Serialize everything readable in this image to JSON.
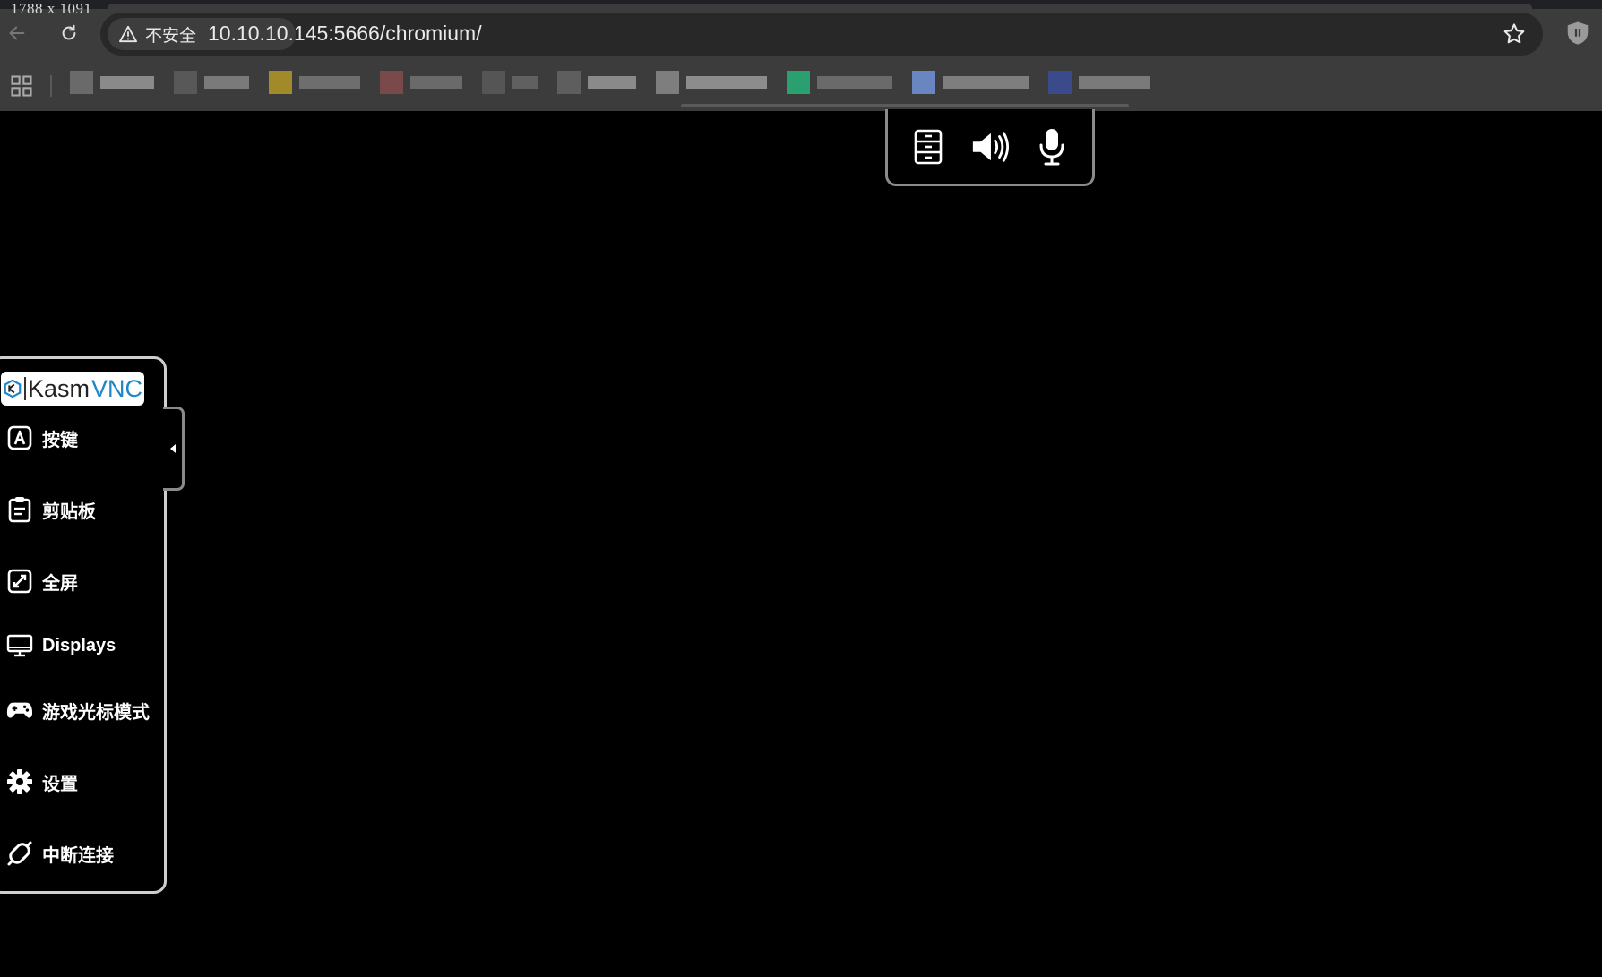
{
  "overlay": {
    "dimensions": "1788 x 1091"
  },
  "browser": {
    "security_label": "不安全",
    "url": "10.10.10.145:5666/chromium/",
    "bookmarks": [
      {
        "ico": "#6a6a6a",
        "txt": "#8a8a8a",
        "w": 60
      },
      {
        "ico": "#585858",
        "txt": "#7a7a7a",
        "w": 50
      },
      {
        "ico": "#a08a2a",
        "txt": "#6e6e6e",
        "w": 68
      },
      {
        "ico": "#7a4a4a",
        "txt": "#6a6a6a",
        "w": 58
      },
      {
        "ico": "#555555",
        "txt": "#606060",
        "w": 28
      },
      {
        "ico": "#5e5e5e",
        "txt": "#8a8a8a",
        "w": 54
      },
      {
        "ico": "#7e7e7e",
        "txt": "#8c8c8c",
        "w": 90
      },
      {
        "ico": "#2aa070",
        "txt": "#6a6a6a",
        "w": 84
      },
      {
        "ico": "#6a86c0",
        "txt": "#7e7e7e",
        "w": 96
      },
      {
        "ico": "#3a4a8a",
        "txt": "#7a7a7a",
        "w": 80
      }
    ]
  },
  "kasm": {
    "logo_kasm": "Kasm",
    "logo_vnc": "VNC",
    "menu": [
      {
        "label": "按键",
        "icon": "keyboard-key-icon"
      },
      {
        "label": "剪贴板",
        "icon": "clipboard-icon"
      },
      {
        "label": "全屏",
        "icon": "fullscreen-icon"
      },
      {
        "label": "Displays",
        "icon": "monitor-icon"
      },
      {
        "label": "游戏光标模式",
        "icon": "gamepad-icon"
      },
      {
        "label": "设置",
        "icon": "gear-icon"
      },
      {
        "label": "中断连接",
        "icon": "disconnect-icon"
      }
    ],
    "top_tools": [
      "file-cabinet-icon",
      "speaker-icon",
      "microphone-icon"
    ]
  },
  "colors": {
    "chrome_bg": "#3c3c3c",
    "omnibox_bg": "#282828",
    "remote_bg": "#000000",
    "kasm_blue": "#1f86c8"
  }
}
